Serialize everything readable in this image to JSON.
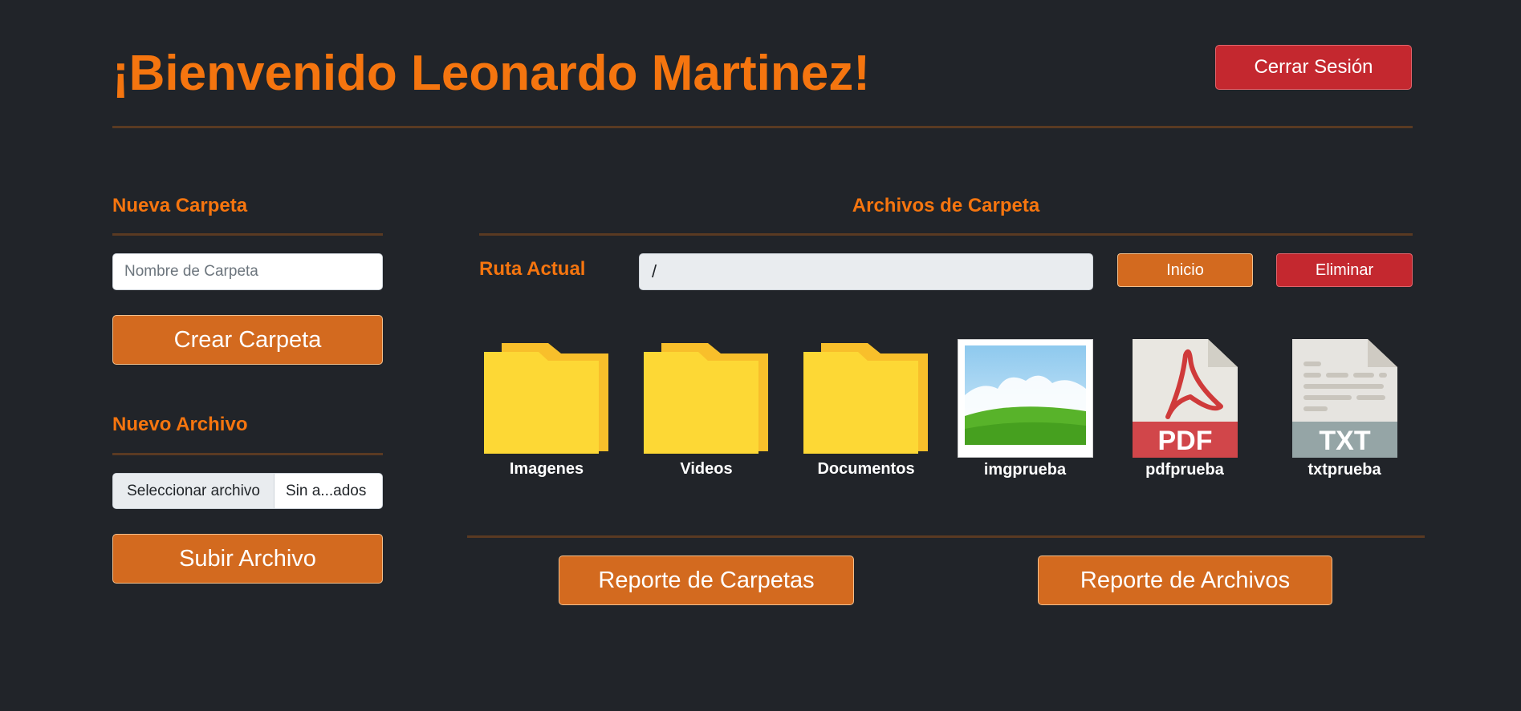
{
  "header": {
    "title": "¡Bienvenido Leonardo Martinez!",
    "logout_label": "Cerrar Sesión"
  },
  "sidebar": {
    "new_folder_heading": "Nueva Carpeta",
    "folder_name_placeholder": "Nombre de Carpeta",
    "create_folder_label": "Crear Carpeta",
    "new_file_heading": "Nuevo Archivo",
    "choose_file_label": "Seleccionar archivo",
    "no_file_label": "Sin a...ados",
    "upload_label": "Subir Archivo"
  },
  "main": {
    "heading": "Archivos de Carpeta",
    "path_label": "Ruta Actual",
    "path_value": "/",
    "home_label": "Inicio",
    "delete_label": "Eliminar",
    "items": [
      {
        "name": "Imagenes",
        "icon": "folder-icon"
      },
      {
        "name": "Videos",
        "icon": "folder-icon"
      },
      {
        "name": "Documentos",
        "icon": "folder-icon"
      },
      {
        "name": "imgprueba",
        "icon": "image-file-icon"
      },
      {
        "name": "pdfprueba",
        "icon": "pdf-file-icon",
        "badge": "PDF"
      },
      {
        "name": "txtprueba",
        "icon": "txt-file-icon",
        "badge": "TXT"
      }
    ],
    "report_folders_label": "Reporte de Carpetas",
    "report_files_label": "Reporte de Archivos"
  },
  "colors": {
    "background": "#212429",
    "accent": "#f5750f",
    "button_orange": "#d36a1f",
    "button_red": "#c4282f",
    "divider": "#5a3a22"
  }
}
